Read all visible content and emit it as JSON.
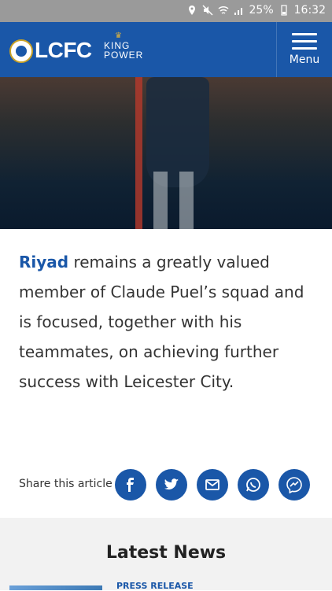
{
  "status_bar": {
    "battery": "25%",
    "time": "16:32"
  },
  "header": {
    "logo_main": "LCFC",
    "logo_sub_1": "KING",
    "logo_sub_2": "POWER",
    "menu_label": "Menu"
  },
  "article": {
    "name": "Riyad",
    "text": " remains a greatly valued member of Claude Puel’s squad and is focused, together with his teammates, on achieving further success with Leicester City."
  },
  "share": {
    "label": "Share this article",
    "buttons": [
      "facebook-icon",
      "twitter-icon",
      "mail-icon",
      "whatsapp-icon",
      "messenger-icon"
    ]
  },
  "latest_news": {
    "title": "Latest News",
    "first_item_tag": "PRESS RELEASE"
  },
  "colors": {
    "brand": "#1a57a8",
    "statusbar": "#9a9a9a"
  }
}
